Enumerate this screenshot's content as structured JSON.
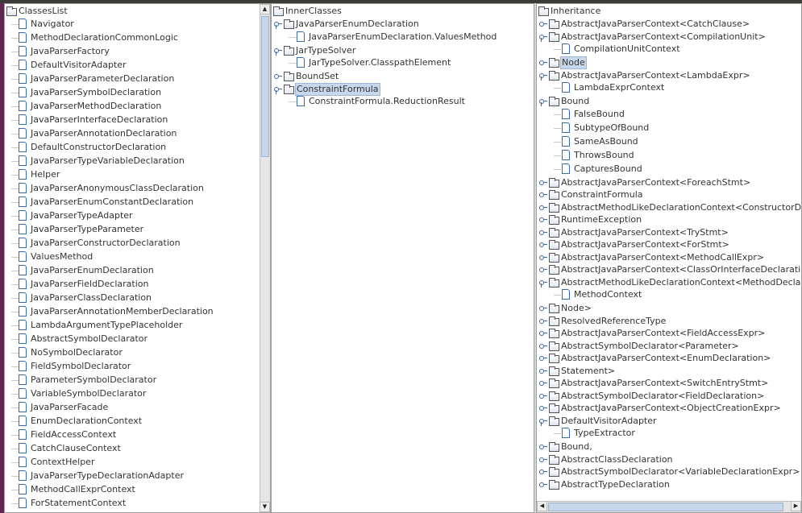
{
  "panels": [
    {
      "id": "classes-list",
      "root": "ClassesList",
      "items": [
        {
          "t": "leaf",
          "l": 1,
          "label": "Navigator"
        },
        {
          "t": "leaf",
          "l": 1,
          "label": "MethodDeclarationCommonLogic"
        },
        {
          "t": "leaf",
          "l": 1,
          "label": "JavaParserFactory"
        },
        {
          "t": "leaf",
          "l": 1,
          "label": "DefaultVisitorAdapter"
        },
        {
          "t": "leaf",
          "l": 1,
          "label": "JavaParserParameterDeclaration"
        },
        {
          "t": "leaf",
          "l": 1,
          "label": "JavaParserSymbolDeclaration"
        },
        {
          "t": "leaf",
          "l": 1,
          "label": "JavaParserMethodDeclaration"
        },
        {
          "t": "leaf",
          "l": 1,
          "label": "JavaParserInterfaceDeclaration"
        },
        {
          "t": "leaf",
          "l": 1,
          "label": "JavaParserAnnotationDeclaration"
        },
        {
          "t": "leaf",
          "l": 1,
          "label": "DefaultConstructorDeclaration"
        },
        {
          "t": "leaf",
          "l": 1,
          "label": "JavaParserTypeVariableDeclaration"
        },
        {
          "t": "leaf",
          "l": 1,
          "label": "Helper"
        },
        {
          "t": "leaf",
          "l": 1,
          "label": "JavaParserAnonymousClassDeclaration"
        },
        {
          "t": "leaf",
          "l": 1,
          "label": "JavaParserEnumConstantDeclaration"
        },
        {
          "t": "leaf",
          "l": 1,
          "label": "JavaParserTypeAdapter"
        },
        {
          "t": "leaf",
          "l": 1,
          "label": "JavaParserTypeParameter"
        },
        {
          "t": "leaf",
          "l": 1,
          "label": "JavaParserConstructorDeclaration"
        },
        {
          "t": "leaf",
          "l": 1,
          "label": "ValuesMethod"
        },
        {
          "t": "leaf",
          "l": 1,
          "label": "JavaParserEnumDeclaration"
        },
        {
          "t": "leaf",
          "l": 1,
          "label": "JavaParserFieldDeclaration"
        },
        {
          "t": "leaf",
          "l": 1,
          "label": "JavaParserClassDeclaration"
        },
        {
          "t": "leaf",
          "l": 1,
          "label": "JavaParserAnnotationMemberDeclaration"
        },
        {
          "t": "leaf",
          "l": 1,
          "label": "LambdaArgumentTypePlaceholder"
        },
        {
          "t": "leaf",
          "l": 1,
          "label": "AbstractSymbolDeclarator"
        },
        {
          "t": "leaf",
          "l": 1,
          "label": "NoSymbolDeclarator"
        },
        {
          "t": "leaf",
          "l": 1,
          "label": "FieldSymbolDeclarator"
        },
        {
          "t": "leaf",
          "l": 1,
          "label": "ParameterSymbolDeclarator"
        },
        {
          "t": "leaf",
          "l": 1,
          "label": "VariableSymbolDeclarator"
        },
        {
          "t": "leaf",
          "l": 1,
          "label": "JavaParserFacade"
        },
        {
          "t": "leaf",
          "l": 1,
          "label": "EnumDeclarationContext"
        },
        {
          "t": "leaf",
          "l": 1,
          "label": "FieldAccessContext"
        },
        {
          "t": "leaf",
          "l": 1,
          "label": "CatchClauseContext"
        },
        {
          "t": "leaf",
          "l": 1,
          "label": "ContextHelper"
        },
        {
          "t": "leaf",
          "l": 1,
          "label": "JavaParserTypeDeclarationAdapter"
        },
        {
          "t": "leaf",
          "l": 1,
          "label": "MethodCallExprContext"
        },
        {
          "t": "leaf",
          "l": 1,
          "label": "ForStatementContext"
        }
      ]
    },
    {
      "id": "inner-classes",
      "root": "InnerClasses",
      "items": [
        {
          "t": "folder",
          "l": 1,
          "open": true,
          "label": "JavaParserEnumDeclaration"
        },
        {
          "t": "leaf",
          "l": 2,
          "label": "JavaParserEnumDeclaration.ValuesMethod"
        },
        {
          "t": "folder",
          "l": 1,
          "open": true,
          "label": "JarTypeSolver"
        },
        {
          "t": "leaf",
          "l": 2,
          "label": "JarTypeSolver.ClasspathElement"
        },
        {
          "t": "folder",
          "l": 1,
          "open": false,
          "label": "BoundSet"
        },
        {
          "t": "folder",
          "l": 1,
          "open": true,
          "label": "ConstraintFormula",
          "selected": true
        },
        {
          "t": "leaf",
          "l": 2,
          "label": "ConstraintFormula.ReductionResult"
        }
      ]
    },
    {
      "id": "inheritance",
      "root": "Inheritance",
      "items": [
        {
          "t": "folder",
          "l": 1,
          "open": false,
          "label": "AbstractJavaParserContext<CatchClause>"
        },
        {
          "t": "folder",
          "l": 1,
          "open": true,
          "label": "AbstractJavaParserContext<CompilationUnit>"
        },
        {
          "t": "leaf",
          "l": 2,
          "label": "CompilationUnitContext"
        },
        {
          "t": "folder",
          "l": 1,
          "open": false,
          "label": "Node",
          "selected": true
        },
        {
          "t": "folder",
          "l": 1,
          "open": true,
          "label": "AbstractJavaParserContext<LambdaExpr>"
        },
        {
          "t": "leaf",
          "l": 2,
          "label": "LambdaExprContext"
        },
        {
          "t": "folder",
          "l": 1,
          "open": true,
          "label": "Bound"
        },
        {
          "t": "leaf",
          "l": 2,
          "label": "FalseBound"
        },
        {
          "t": "leaf",
          "l": 2,
          "label": "SubtypeOfBound"
        },
        {
          "t": "leaf",
          "l": 2,
          "label": "SameAsBound"
        },
        {
          "t": "leaf",
          "l": 2,
          "label": "ThrowsBound"
        },
        {
          "t": "leaf",
          "l": 2,
          "label": "CapturesBound"
        },
        {
          "t": "folder",
          "l": 1,
          "open": false,
          "label": "AbstractJavaParserContext<ForeachStmt>"
        },
        {
          "t": "folder",
          "l": 1,
          "open": false,
          "label": "ConstraintFormula"
        },
        {
          "t": "folder",
          "l": 1,
          "open": false,
          "label": "AbstractMethodLikeDeclarationContext<ConstructorDeclaration>"
        },
        {
          "t": "folder",
          "l": 1,
          "open": false,
          "label": "RuntimeException"
        },
        {
          "t": "folder",
          "l": 1,
          "open": false,
          "label": "AbstractJavaParserContext<TryStmt>"
        },
        {
          "t": "folder",
          "l": 1,
          "open": false,
          "label": "AbstractJavaParserContext<ForStmt>"
        },
        {
          "t": "folder",
          "l": 1,
          "open": false,
          "label": "AbstractJavaParserContext<MethodCallExpr>"
        },
        {
          "t": "folder",
          "l": 1,
          "open": false,
          "label": "AbstractJavaParserContext<ClassOrInterfaceDeclaration>"
        },
        {
          "t": "folder",
          "l": 1,
          "open": true,
          "label": "AbstractMethodLikeDeclarationContext<MethodDeclaration>"
        },
        {
          "t": "leaf",
          "l": 2,
          "label": "MethodContext"
        },
        {
          "t": "folder",
          "l": 1,
          "open": false,
          "label": "Node>"
        },
        {
          "t": "folder",
          "l": 1,
          "open": false,
          "label": "ResolvedReferenceType"
        },
        {
          "t": "folder",
          "l": 1,
          "open": false,
          "label": "AbstractJavaParserContext<FieldAccessExpr>"
        },
        {
          "t": "folder",
          "l": 1,
          "open": false,
          "label": "AbstractSymbolDeclarator<Parameter>"
        },
        {
          "t": "folder",
          "l": 1,
          "open": false,
          "label": "AbstractJavaParserContext<EnumDeclaration>"
        },
        {
          "t": "folder",
          "l": 1,
          "open": false,
          "label": "Statement>"
        },
        {
          "t": "folder",
          "l": 1,
          "open": false,
          "label": "AbstractJavaParserContext<SwitchEntryStmt>"
        },
        {
          "t": "folder",
          "l": 1,
          "open": false,
          "label": "AbstractSymbolDeclarator<FieldDeclaration>"
        },
        {
          "t": "folder",
          "l": 1,
          "open": false,
          "label": "AbstractJavaParserContext<ObjectCreationExpr>"
        },
        {
          "t": "folder",
          "l": 1,
          "open": true,
          "label": "DefaultVisitorAdapter"
        },
        {
          "t": "leaf",
          "l": 2,
          "label": "TypeExtractor"
        },
        {
          "t": "folder",
          "l": 1,
          "open": false,
          "label": "Bound,"
        },
        {
          "t": "folder",
          "l": 1,
          "open": false,
          "label": "AbstractClassDeclaration"
        },
        {
          "t": "folder",
          "l": 1,
          "open": false,
          "label": "AbstractSymbolDeclarator<VariableDeclarationExpr>"
        },
        {
          "t": "folder",
          "l": 1,
          "open": false,
          "label": "AbstractTypeDeclaration"
        }
      ]
    }
  ]
}
